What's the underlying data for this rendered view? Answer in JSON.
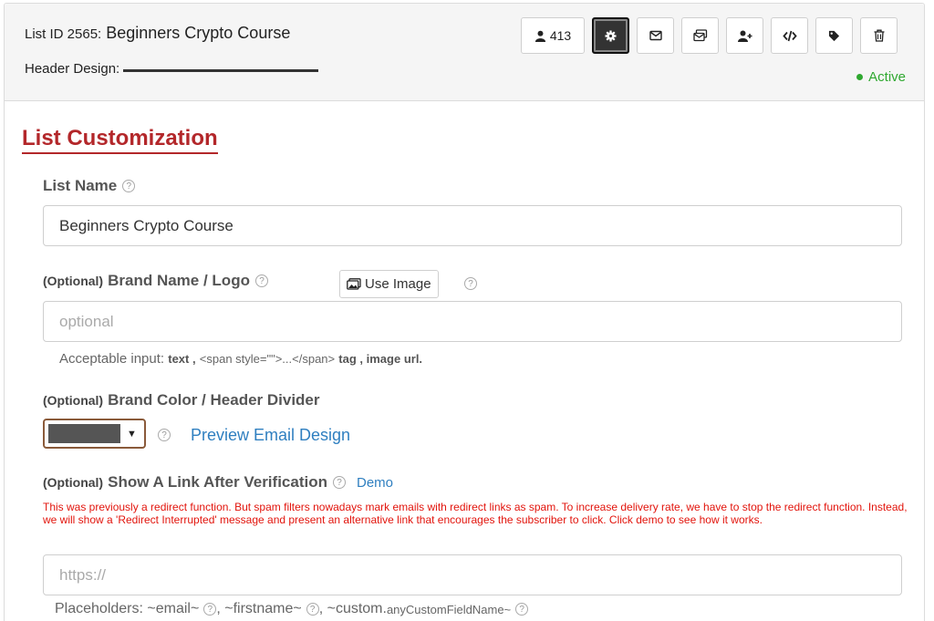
{
  "header": {
    "title_prefix": "List ID 2565:",
    "title": "Beginners Crypto Course",
    "design_label": "Header Design:",
    "status": "Active",
    "subscriber_count": "413"
  },
  "section_title": "List Customization",
  "list_name": {
    "label": "List Name",
    "value": "Beginners Crypto Course"
  },
  "brand": {
    "optional": "(Optional)",
    "label": "Brand Name / Logo",
    "use_image": "Use Image",
    "placeholder": "optional",
    "hint_prefix": "Acceptable input:",
    "hint_text": "text ,",
    "hint_tag": "<span style=\"\">...</span>",
    "hint_tag_suffix": "tag , image url."
  },
  "color": {
    "optional": "(Optional)",
    "label": "Brand Color / Header Divider",
    "swatch": "#555555",
    "preview_link": "Preview Email Design"
  },
  "redirect": {
    "optional": "(Optional)",
    "label": "Show A Link After Verification",
    "demo": "Demo",
    "warning": "This was previously a redirect function. But spam filters nowadays mark emails with redirect links as spam. To increase delivery rate, we have to stop the redirect function. Instead, we will show a 'Redirect Interrupted' message and present an alternative link that encourages the subscriber to click. Click demo to see how it works.",
    "placeholder": "https://"
  },
  "placeholders": {
    "prefix": "Placeholders:",
    "email": "~email~",
    "firstname": "~firstname~",
    "custom": "~custom.",
    "custom_field": "anyCustomFieldName~"
  },
  "icons": [
    "user-icon",
    "gear-icon",
    "envelope-icon",
    "envelopes-icon",
    "add-user-icon",
    "code-icon",
    "tag-icon",
    "trash-icon",
    "image-icon",
    "help-icon"
  ],
  "colors": {
    "accent_red": "#b3272a",
    "link_blue": "#2f7fc0",
    "status_green": "#2fa830",
    "warning_red": "#e2140c"
  }
}
